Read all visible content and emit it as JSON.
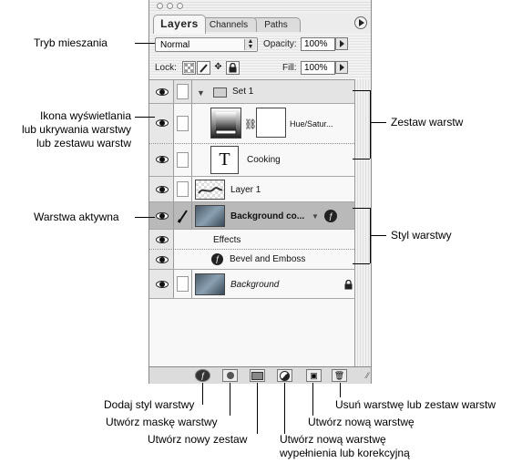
{
  "palette": {
    "tabs": [
      "Layers",
      "Channels",
      "Paths"
    ],
    "blend_mode": "Normal",
    "opacity_label": "Opacity:",
    "opacity_value": "100%",
    "lock_label": "Lock:",
    "fill_label": "Fill:",
    "fill_value": "100%",
    "layers": {
      "set1": "Set 1",
      "adjustment": "Hue/Satur...",
      "text_layer": "Cooking",
      "text_thumb": "T",
      "layer1": "Layer 1",
      "background_copy": "Background co...",
      "effects": "Effects",
      "bevel": "Bevel and Emboss",
      "background": "Background"
    }
  },
  "annotations": {
    "blend_mode": "Tryb mieszania",
    "visibility": [
      "Ikona wyświetlania",
      "lub ukrywania warstwy",
      "lub zestawu warstw"
    ],
    "active_layer": "Warstwa aktywna",
    "layer_set": "Zestaw warstw",
    "layer_style": "Styl warstwy",
    "add_style": "Dodaj styl warstwy",
    "add_mask": "Utwórz maskę warstwy",
    "new_set": "Utwórz nowy zestaw",
    "new_fill": [
      "Utwórz nową warstwę",
      "wypełnienia lub korekcyjną"
    ],
    "new_layer": "Utwórz nową warstwę",
    "delete": "Usuń warstwę lub zestaw warstw"
  },
  "colors": {
    "active_row": "#b9b9b9",
    "set_row": "#e4e4e4"
  }
}
